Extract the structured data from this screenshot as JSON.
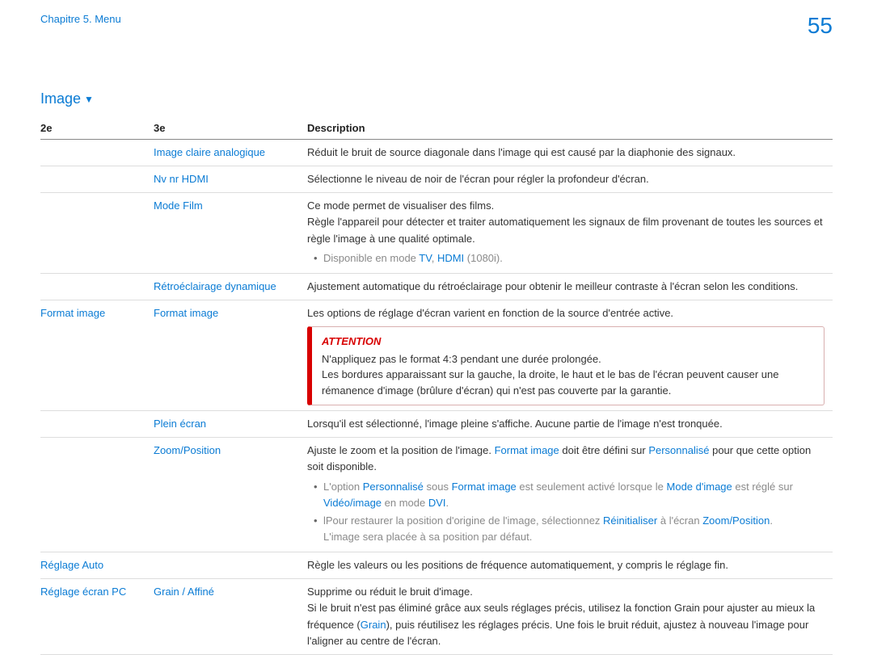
{
  "header": {
    "chapter": "Chapitre 5. Menu",
    "page": "55"
  },
  "section": {
    "title": "Image",
    "arrow": "▼"
  },
  "table": {
    "headers": {
      "c1": "2e",
      "c2": "3e",
      "c3": "Description"
    }
  },
  "rows": {
    "r1": {
      "c2": "Image claire analogique",
      "desc": "Réduit le bruit de source diagonale dans l'image qui est causé par la diaphonie des signaux."
    },
    "r2": {
      "c2": "Nv nr HDMI",
      "desc": "Sélectionne le niveau de noir de l'écran pour régler la profondeur d'écran."
    },
    "r3": {
      "c2": "Mode Film",
      "d1": "Ce mode permet de visualiser des films.",
      "d2": "Règle l'appareil pour détecter et traiter automatiquement les signaux de film provenant de toutes les sources et règle l'image à une qualité optimale.",
      "b_pre": "Disponible en mode ",
      "b_tv": "TV",
      "b_comma": ", ",
      "b_hdmi": "HDMI",
      "b_post": " (1080i)."
    },
    "r4": {
      "c2": "Rétroéclairage dynamique",
      "desc": "Ajustement automatique du rétroéclairage pour obtenir le meilleur contraste à l'écran selon les conditions."
    },
    "r5": {
      "c1": "Format image",
      "c2": "Format image",
      "desc": "Les options de réglage d'écran varient en fonction de la source d'entrée active.",
      "att_title": "ATTENTION",
      "att1": "N'appliquez pas le format 4:3 pendant une durée prolongée.",
      "att2": "Les bordures apparaissant sur la gauche, la droite, le haut et le bas de l'écran peuvent causer une rémanence d'image (brûlure d'écran) qui n'est pas couverte par la garantie."
    },
    "r6": {
      "c2": "Plein écran",
      "desc": "Lorsqu'il est sélectionné, l'image pleine s'affiche. Aucune partie de l'image n'est tronquée."
    },
    "r7": {
      "c2": "Zoom/Position",
      "d_pre": "Ajuste le zoom et la position de l'image. ",
      "d_fi": "Format image",
      "d_mid": " doit être défini sur ",
      "d_perso": "Personnalisé",
      "d_post": " pour que cette option soit disponible.",
      "b1_pre": "L'option ",
      "b1_perso": "Personnalisé",
      "b1_s1": " sous ",
      "b1_fi": "Format image",
      "b1_s2": " est seulement activé lorsque le ",
      "b1_mi": "Mode d'image",
      "b1_s3": " est réglé sur ",
      "b1_vi": "Vidéo/image",
      "b1_s4": " en mode ",
      "b1_dvi": "DVI",
      "b1_dot": ".",
      "b2_pre": "lPour restaurer la position d'origine de l'image, sélectionnez ",
      "b2_re": "Réinitialiser",
      "b2_mid": " à l'écran ",
      "b2_zp": "Zoom/Position",
      "b2_dot": ".",
      "b2_line2": "L'image sera placée à sa position par défaut."
    },
    "r8": {
      "c1": "Réglage Auto",
      "desc": "Règle les valeurs ou les positions de fréquence automatiquement, y compris le réglage fin."
    },
    "r9": {
      "c1": "Réglage écran PC",
      "c2": "Grain / Affiné",
      "d1": "Supprime ou réduit le bruit d'image.",
      "d2_pre": "Si le bruit n'est pas éliminé grâce aux seuls réglages précis, utilisez la fonction Grain pour ajuster au mieux la fréquence (",
      "d2_grain": "Grain",
      "d2_post": "), puis réutilisez les réglages précis. Une fois le bruit réduit, ajustez à nouveau l'image pour l'aligner au centre de l'écran."
    }
  }
}
